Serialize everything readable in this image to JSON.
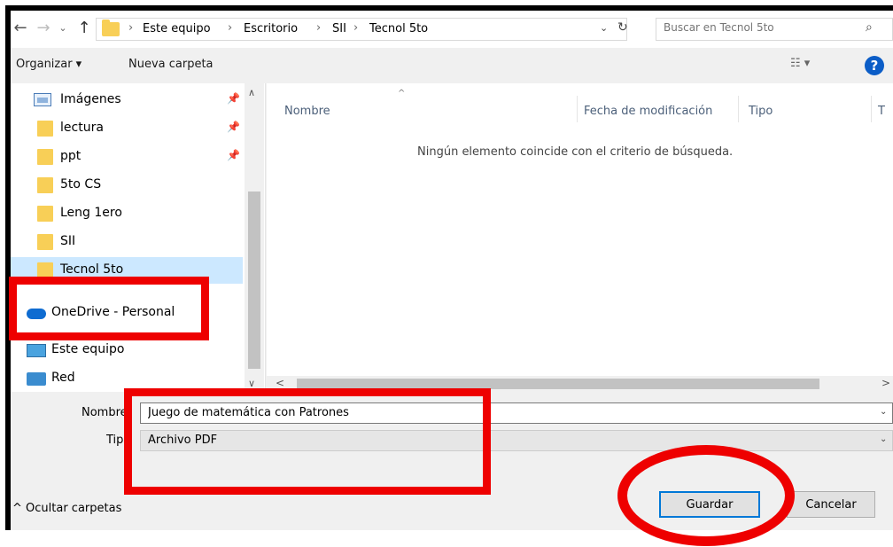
{
  "nav_buttons": {
    "back": "←",
    "forward": "→",
    "recent": "⌄",
    "up": "↑"
  },
  "breadcrumb": {
    "items": [
      "Este equipo",
      "Escritorio",
      "SII",
      "Tecnol 5to"
    ],
    "separator": "›",
    "dropdown_glyph": "⌄",
    "refresh_glyph": "↻"
  },
  "search": {
    "placeholder": "Buscar en Tecnol 5to",
    "icon_glyph": "⌕"
  },
  "toolbar": {
    "organize_label": "Organizar ▾",
    "new_folder_label": "Nueva carpeta",
    "view_glyph": "☷ ▾",
    "help_glyph": "?"
  },
  "sidebar": {
    "items": [
      {
        "label": "Imágenes",
        "icon": "pictures-icon",
        "pinned": true
      },
      {
        "label": "lectura",
        "icon": "folder-icon",
        "pinned": true
      },
      {
        "label": "ppt",
        "icon": "folder-icon",
        "pinned": true
      },
      {
        "label": "5to CS",
        "icon": "folder-icon",
        "pinned": false
      },
      {
        "label": "Leng 1ero",
        "icon": "folder-icon",
        "pinned": false
      },
      {
        "label": "SII",
        "icon": "folder-icon",
        "pinned": false
      },
      {
        "label": "Tecnol 5to",
        "icon": "folder-icon",
        "pinned": false,
        "selected": true
      },
      {
        "label": "OneDrive - Personal",
        "icon": "onedrive-cloud-icon",
        "pinned": false
      },
      {
        "label": "Este equipo",
        "icon": "this-pc-icon",
        "pinned": false
      },
      {
        "label": "Red",
        "icon": "network-icon",
        "pinned": false
      }
    ],
    "pin_glyph": "📌",
    "scroll_up": "∧",
    "scroll_down": "∨"
  },
  "file_list": {
    "columns": [
      "Nombre",
      "Fecha de modificación",
      "Tipo",
      "T"
    ],
    "sort_glyph": "^",
    "empty_message": "Ningún elemento coincide con el criterio de búsqueda.",
    "scroll_left": "<",
    "scroll_right": ">"
  },
  "form": {
    "filename_label": "Nombre",
    "filename_value": "Juego de matemática con Patrones",
    "type_label": "Tipo",
    "type_value": "Archivo PDF",
    "dropdown_glyph": "⌄"
  },
  "footer": {
    "hide_folders_label": "^  Ocultar carpetas",
    "save_label": "Guardar",
    "cancel_label": "Cancelar"
  },
  "annotation_color": "#ee0000",
  "accent_color": "#0078d7",
  "selection_color": "#cce8ff"
}
